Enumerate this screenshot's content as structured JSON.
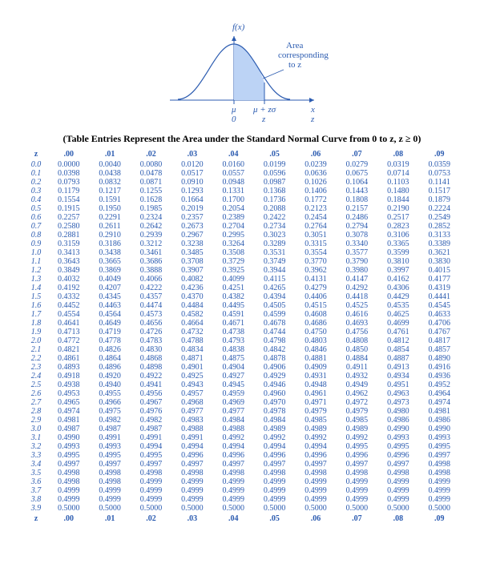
{
  "diagram": {
    "fx_label": "f(x)",
    "note_lines": [
      "Area",
      "corresponding",
      "to z"
    ],
    "mu_label": "μ",
    "mz_label": "μ + zσ",
    "zero_label": "0",
    "z_label": "z",
    "x_axis_right_x": "x",
    "x_axis_right_z": "z"
  },
  "title": "(Table Entries Represent the Area under the Standard Normal Curve from 0 to z, z ≥ 0)",
  "chart_data": {
    "type": "table",
    "title": "Standard Normal Curve — area from 0 to z",
    "columns": [
      ".00",
      ".01",
      ".02",
      ".03",
      ".04",
      ".05",
      ".06",
      ".07",
      ".08",
      ".09"
    ],
    "row_labels": [
      "0.0",
      "0.1",
      "0.2",
      "0.3",
      "0.4",
      "0.5",
      "0.6",
      "0.7",
      "0.8",
      "0.9",
      "1.0",
      "1.1",
      "1.2",
      "1.3",
      "1.4",
      "1.5",
      "1.6",
      "1.7",
      "1.8",
      "1.9",
      "2.0",
      "2.1",
      "2.2",
      "2.3",
      "2.4",
      "2.5",
      "2.6",
      "2.7",
      "2.8",
      "2.9",
      "3.0",
      "3.1",
      "3.2",
      "3.3",
      "3.4",
      "3.5",
      "3.6",
      "3.7",
      "3.8",
      "3.9"
    ],
    "values": [
      [
        "0.0000",
        "0.0040",
        "0.0080",
        "0.0120",
        "0.0160",
        "0.0199",
        "0.0239",
        "0.0279",
        "0.0319",
        "0.0359"
      ],
      [
        "0.0398",
        "0.0438",
        "0.0478",
        "0.0517",
        "0.0557",
        "0.0596",
        "0.0636",
        "0.0675",
        "0.0714",
        "0.0753"
      ],
      [
        "0.0793",
        "0.0832",
        "0.0871",
        "0.0910",
        "0.0948",
        "0.0987",
        "0.1026",
        "0.1064",
        "0.1103",
        "0.1141"
      ],
      [
        "0.1179",
        "0.1217",
        "0.1255",
        "0.1293",
        "0.1331",
        "0.1368",
        "0.1406",
        "0.1443",
        "0.1480",
        "0.1517"
      ],
      [
        "0.1554",
        "0.1591",
        "0.1628",
        "0.1664",
        "0.1700",
        "0.1736",
        "0.1772",
        "0.1808",
        "0.1844",
        "0.1879"
      ],
      [
        "0.1915",
        "0.1950",
        "0.1985",
        "0.2019",
        "0.2054",
        "0.2088",
        "0.2123",
        "0.2157",
        "0.2190",
        "0.2224"
      ],
      [
        "0.2257",
        "0.2291",
        "0.2324",
        "0.2357",
        "0.2389",
        "0.2422",
        "0.2454",
        "0.2486",
        "0.2517",
        "0.2549"
      ],
      [
        "0.2580",
        "0.2611",
        "0.2642",
        "0.2673",
        "0.2704",
        "0.2734",
        "0.2764",
        "0.2794",
        "0.2823",
        "0.2852"
      ],
      [
        "0.2881",
        "0.2910",
        "0.2939",
        "0.2967",
        "0.2995",
        "0.3023",
        "0.3051",
        "0.3078",
        "0.3106",
        "0.3133"
      ],
      [
        "0.3159",
        "0.3186",
        "0.3212",
        "0.3238",
        "0.3264",
        "0.3289",
        "0.3315",
        "0.3340",
        "0.3365",
        "0.3389"
      ],
      [
        "0.3413",
        "0.3438",
        "0.3461",
        "0.3485",
        "0.3508",
        "0.3531",
        "0.3554",
        "0.3577",
        "0.3599",
        "0.3621"
      ],
      [
        "0.3643",
        "0.3665",
        "0.3686",
        "0.3708",
        "0.3729",
        "0.3749",
        "0.3770",
        "0.3790",
        "0.3810",
        "0.3830"
      ],
      [
        "0.3849",
        "0.3869",
        "0.3888",
        "0.3907",
        "0.3925",
        "0.3944",
        "0.3962",
        "0.3980",
        "0.3997",
        "0.4015"
      ],
      [
        "0.4032",
        "0.4049",
        "0.4066",
        "0.4082",
        "0.4099",
        "0.4115",
        "0.4131",
        "0.4147",
        "0.4162",
        "0.4177"
      ],
      [
        "0.4192",
        "0.4207",
        "0.4222",
        "0.4236",
        "0.4251",
        "0.4265",
        "0.4279",
        "0.4292",
        "0.4306",
        "0.4319"
      ],
      [
        "0.4332",
        "0.4345",
        "0.4357",
        "0.4370",
        "0.4382",
        "0.4394",
        "0.4406",
        "0.4418",
        "0.4429",
        "0.4441"
      ],
      [
        "0.4452",
        "0.4463",
        "0.4474",
        "0.4484",
        "0.4495",
        "0.4505",
        "0.4515",
        "0.4525",
        "0.4535",
        "0.4545"
      ],
      [
        "0.4554",
        "0.4564",
        "0.4573",
        "0.4582",
        "0.4591",
        "0.4599",
        "0.4608",
        "0.4616",
        "0.4625",
        "0.4633"
      ],
      [
        "0.4641",
        "0.4649",
        "0.4656",
        "0.4664",
        "0.4671",
        "0.4678",
        "0.4686",
        "0.4693",
        "0.4699",
        "0.4706"
      ],
      [
        "0.4713",
        "0.4719",
        "0.4726",
        "0.4732",
        "0.4738",
        "0.4744",
        "0.4750",
        "0.4756",
        "0.4761",
        "0.4767"
      ],
      [
        "0.4772",
        "0.4778",
        "0.4783",
        "0.4788",
        "0.4793",
        "0.4798",
        "0.4803",
        "0.4808",
        "0.4812",
        "0.4817"
      ],
      [
        "0.4821",
        "0.4826",
        "0.4830",
        "0.4834",
        "0.4838",
        "0.4842",
        "0.4846",
        "0.4850",
        "0.4854",
        "0.4857"
      ],
      [
        "0.4861",
        "0.4864",
        "0.4868",
        "0.4871",
        "0.4875",
        "0.4878",
        "0.4881",
        "0.4884",
        "0.4887",
        "0.4890"
      ],
      [
        "0.4893",
        "0.4896",
        "0.4898",
        "0.4901",
        "0.4904",
        "0.4906",
        "0.4909",
        "0.4911",
        "0.4913",
        "0.4916"
      ],
      [
        "0.4918",
        "0.4920",
        "0.4922",
        "0.4925",
        "0.4927",
        "0.4929",
        "0.4931",
        "0.4932",
        "0.4934",
        "0.4936"
      ],
      [
        "0.4938",
        "0.4940",
        "0.4941",
        "0.4943",
        "0.4945",
        "0.4946",
        "0.4948",
        "0.4949",
        "0.4951",
        "0.4952"
      ],
      [
        "0.4953",
        "0.4955",
        "0.4956",
        "0.4957",
        "0.4959",
        "0.4960",
        "0.4961",
        "0.4962",
        "0.4963",
        "0.4964"
      ],
      [
        "0.4965",
        "0.4966",
        "0.4967",
        "0.4968",
        "0.4969",
        "0.4970",
        "0.4971",
        "0.4972",
        "0.4973",
        "0.4974"
      ],
      [
        "0.4974",
        "0.4975",
        "0.4976",
        "0.4977",
        "0.4977",
        "0.4978",
        "0.4979",
        "0.4979",
        "0.4980",
        "0.4981"
      ],
      [
        "0.4981",
        "0.4982",
        "0.4982",
        "0.4983",
        "0.4984",
        "0.4984",
        "0.4985",
        "0.4985",
        "0.4986",
        "0.4986"
      ],
      [
        "0.4987",
        "0.4987",
        "0.4987",
        "0.4988",
        "0.4988",
        "0.4989",
        "0.4989",
        "0.4989",
        "0.4990",
        "0.4990"
      ],
      [
        "0.4990",
        "0.4991",
        "0.4991",
        "0.4991",
        "0.4992",
        "0.4992",
        "0.4992",
        "0.4992",
        "0.4993",
        "0.4993"
      ],
      [
        "0.4993",
        "0.4993",
        "0.4994",
        "0.4994",
        "0.4994",
        "0.4994",
        "0.4994",
        "0.4995",
        "0.4995",
        "0.4995"
      ],
      [
        "0.4995",
        "0.4995",
        "0.4995",
        "0.4996",
        "0.4996",
        "0.4996",
        "0.4996",
        "0.4996",
        "0.4996",
        "0.4997"
      ],
      [
        "0.4997",
        "0.4997",
        "0.4997",
        "0.4997",
        "0.4997",
        "0.4997",
        "0.4997",
        "0.4997",
        "0.4997",
        "0.4998"
      ],
      [
        "0.4998",
        "0.4998",
        "0.4998",
        "0.4998",
        "0.4998",
        "0.4998",
        "0.4998",
        "0.4998",
        "0.4998",
        "0.4998"
      ],
      [
        "0.4998",
        "0.4998",
        "0.4999",
        "0.4999",
        "0.4999",
        "0.4999",
        "0.4999",
        "0.4999",
        "0.4999",
        "0.4999"
      ],
      [
        "0.4999",
        "0.4999",
        "0.4999",
        "0.4999",
        "0.4999",
        "0.4999",
        "0.4999",
        "0.4999",
        "0.4999",
        "0.4999"
      ],
      [
        "0.4999",
        "0.4999",
        "0.4999",
        "0.4999",
        "0.4999",
        "0.4999",
        "0.4999",
        "0.4999",
        "0.4999",
        "0.4999"
      ],
      [
        "0.5000",
        "0.5000",
        "0.5000",
        "0.5000",
        "0.5000",
        "0.5000",
        "0.5000",
        "0.5000",
        "0.5000",
        "0.5000"
      ]
    ]
  },
  "z_header": "z"
}
